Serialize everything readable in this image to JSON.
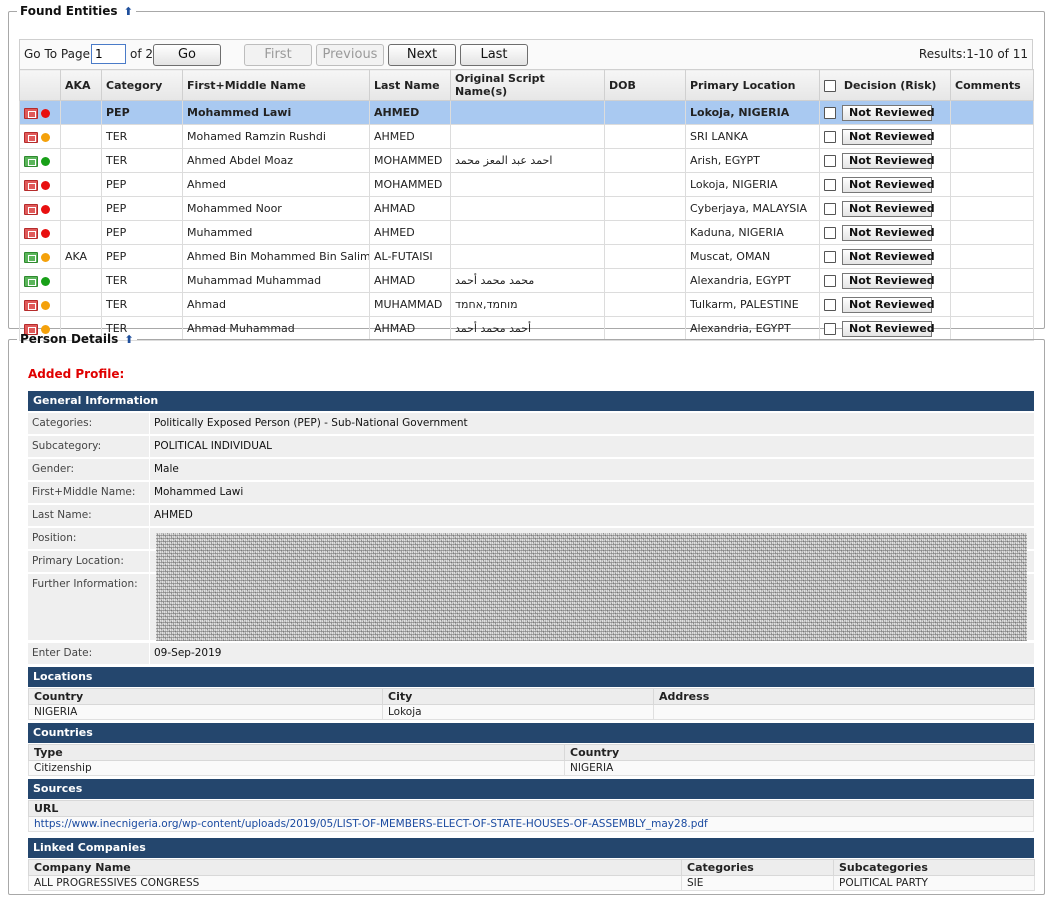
{
  "found_entities": {
    "legend": "Found Entities",
    "pager": {
      "go_to_page_label": "Go To Page",
      "page_value": "1",
      "of_label": "of 2",
      "go_label": "Go",
      "first_label": "First",
      "previous_label": "Previous",
      "next_label": "Next",
      "last_label": "Last",
      "results": "Results:1-10 of 11"
    },
    "columns": [
      "AKA",
      "Category",
      "First+Middle Name",
      "Last Name",
      "Original Script Name(s)",
      "DOB",
      "Primary Location",
      "Decision (Risk)",
      "Comments"
    ],
    "decision_label": "Not Reviewed",
    "rows": [
      {
        "icon": "file-red-icon",
        "icon_color": "red",
        "dot": "#e81010",
        "aka": "",
        "category": "PEP",
        "first": "Mohammed Lawi",
        "last": "AHMED",
        "script": "",
        "dob": "",
        "location": "Lokoja, NIGERIA",
        "selected": true
      },
      {
        "icon": "file-red-icon",
        "icon_color": "red",
        "dot": "#f4a10b",
        "aka": "",
        "category": "TER",
        "first": "Mohamed Ramzin Rushdi",
        "last": "AHMED",
        "script": "",
        "dob": "",
        "location": "SRI LANKA",
        "selected": false
      },
      {
        "icon": "file-green-icon",
        "icon_color": "green",
        "dot": "#18a018",
        "aka": "",
        "category": "TER",
        "first": "Ahmed Abdel Moaz",
        "last": "MOHAMMED",
        "script": "احمد عبد المعز محمد",
        "dob": "",
        "location": "Arish, EGYPT",
        "selected": false
      },
      {
        "icon": "file-red-icon",
        "icon_color": "red",
        "dot": "#e81010",
        "aka": "",
        "category": "PEP",
        "first": "Ahmed",
        "last": "MOHAMMED",
        "script": "",
        "dob": "",
        "location": "Lokoja, NIGERIA",
        "selected": false
      },
      {
        "icon": "file-red-icon",
        "icon_color": "red",
        "dot": "#e81010",
        "aka": "",
        "category": "PEP",
        "first": "Mohammed Noor",
        "last": "AHMAD",
        "script": "",
        "dob": "",
        "location": "Cyberjaya, MALAYSIA",
        "selected": false
      },
      {
        "icon": "file-red-icon",
        "icon_color": "red",
        "dot": "#e81010",
        "aka": "",
        "category": "PEP",
        "first": "Muhammed",
        "last": "AHMED",
        "script": "",
        "dob": "",
        "location": "Kaduna, NIGERIA",
        "selected": false
      },
      {
        "icon": "file-green-icon",
        "icon_color": "green",
        "dot": "#f4a10b",
        "aka": "AKA",
        "category": "PEP",
        "first": "Ahmed Bin Mohammed Bin Salim",
        "last": "AL-FUTAISI",
        "script": "",
        "dob": "",
        "location": "Muscat, OMAN",
        "selected": false
      },
      {
        "icon": "file-green-icon",
        "icon_color": "green",
        "dot": "#18a018",
        "aka": "",
        "category": "TER",
        "first": "Muhammad Muhammad",
        "last": "AHMAD",
        "script": "محمد محمد أحمد",
        "dob": "",
        "location": "Alexandria, EGYPT",
        "selected": false
      },
      {
        "icon": "file-red-icon",
        "icon_color": "red",
        "dot": "#f4a10b",
        "aka": "",
        "category": "TER",
        "first": "Ahmad",
        "last": "MUHAMMAD",
        "script": "מוחמד,אחמד",
        "dob": "",
        "location": "Tulkarm, PALESTINE",
        "selected": false
      },
      {
        "icon": "file-red-icon",
        "icon_color": "red",
        "dot": "#f4a10b",
        "aka": "",
        "category": "TER",
        "first": "Ahmad Muhammad",
        "last": "AHMAD",
        "script": "أحمد محمد أحمد",
        "dob": "",
        "location": "Alexandria, EGYPT",
        "selected": false
      }
    ]
  },
  "person_details": {
    "legend": "Person Details",
    "added_profile": "Added Profile:",
    "general": {
      "title": "General Information",
      "categories_k": "Categories:",
      "categories_v": "Politically Exposed Person (PEP) - Sub-National Government",
      "subcategory_k": "Subcategory:",
      "subcategory_v": "POLITICAL INDIVIDUAL",
      "gender_k": "Gender:",
      "gender_v": "Male",
      "first_k": "First+Middle Name:",
      "first_v": "Mohammed Lawi",
      "last_k": "Last Name:",
      "last_v": "AHMED",
      "position_k": "Position:",
      "primary_k": "Primary Location:",
      "further_k": "Further Information:",
      "enter_k": "Enter Date:",
      "enter_v": "09-Sep-2019"
    },
    "locations": {
      "title": "Locations",
      "h_country": "Country",
      "h_city": "City",
      "h_address": "Address",
      "country": "NIGERIA",
      "city": "Lokoja",
      "address": ""
    },
    "countries": {
      "title": "Countries",
      "h_type": "Type",
      "h_country": "Country",
      "type": "Citizenship",
      "country": "NIGERIA"
    },
    "sources": {
      "title": "Sources",
      "h_url": "URL",
      "url": "https://www.inecnigeria.org/wp-content/uploads/2019/05/LIST-OF-MEMBERS-ELECT-OF-STATE-HOUSES-OF-ASSEMBLY_may28.pdf"
    },
    "linked": {
      "title": "Linked Companies",
      "h_name": "Company Name",
      "h_categories": "Categories",
      "h_sub": "Subcategories",
      "name": "ALL PROGRESSIVES CONGRESS",
      "categories": "SIE",
      "sub": "POLITICAL PARTY"
    }
  }
}
